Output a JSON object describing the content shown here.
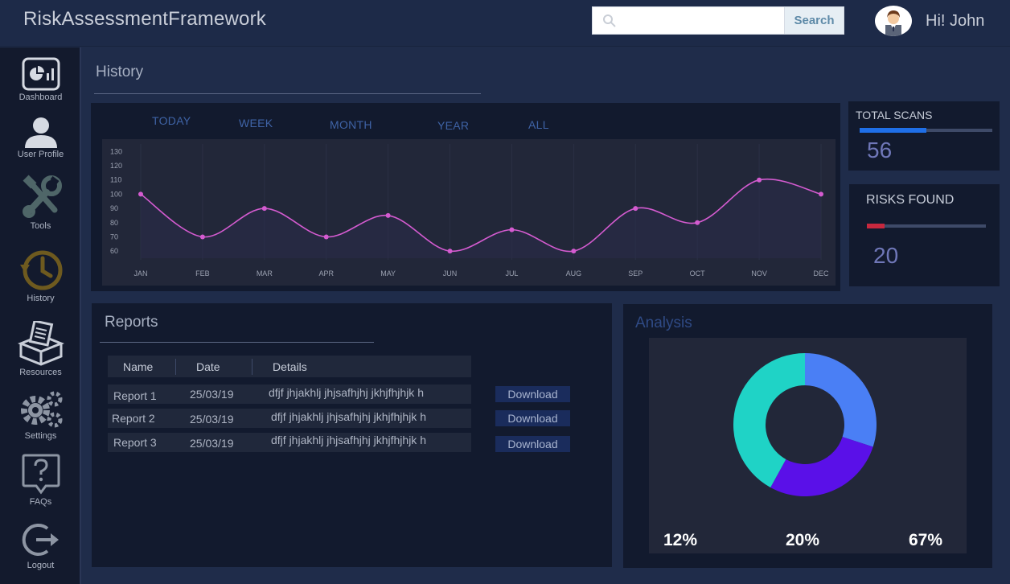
{
  "app": {
    "title": "RiskAssessmentFramework"
  },
  "header": {
    "search_placeholder": "",
    "search_button": "Search",
    "greeting": "Hi! John"
  },
  "sidebar": {
    "items": [
      {
        "label": "Dashboard",
        "icon": "dashboard-icon"
      },
      {
        "label": "User Profile",
        "icon": "user-icon"
      },
      {
        "label": "Tools",
        "icon": "tools-icon"
      },
      {
        "label": "History",
        "icon": "history-icon"
      },
      {
        "label": "Resources",
        "icon": "resources-box-icon"
      },
      {
        "label": "Settings",
        "icon": "settings-gears-icon"
      },
      {
        "label": "FAQs",
        "icon": "question-icon"
      },
      {
        "label": "Logout",
        "icon": "logout-icon"
      }
    ]
  },
  "history": {
    "title": "History",
    "tabs": [
      "TODAY",
      "WEEK",
      "MONTH",
      "YEAR",
      "ALL"
    ]
  },
  "stats": {
    "total_scans": {
      "label": "TOTAL SCANS",
      "value": "56",
      "fill": 0.5,
      "color": "#1f6fe8"
    },
    "risks_found": {
      "label": "RISKS FOUND",
      "value": "20",
      "fill": 0.15,
      "color": "#c8283e"
    }
  },
  "reports": {
    "title": "Reports",
    "columns": [
      "Name",
      "Date",
      "Details"
    ],
    "rows": [
      {
        "name": "Report 1",
        "date": "25/03/19",
        "details": "dfjf jhjakhlj jhjsafhjhj jkhjfhjhjk h",
        "action": "Download"
      },
      {
        "name": "Report 2",
        "date": "25/03/19",
        "details": "dfjf jhjakhlj jhjsafhjhj jkhjfhjhjk h",
        "action": "Download"
      },
      {
        "name": "Report 3",
        "date": "25/03/19",
        "details": "dfjf jhjakhlj jhjsafhjhj jkhjfhjhjk h",
        "action": "Download"
      }
    ]
  },
  "analysis": {
    "title": "Analysis",
    "labels": [
      "12%",
      "20%",
      "67%"
    ]
  },
  "chart_data": [
    {
      "type": "line",
      "title": "",
      "xlabel": "",
      "ylabel": "",
      "categories": [
        "JAN",
        "FEB",
        "MAR",
        "APR",
        "MAY",
        "JUN",
        "JUL",
        "AUG",
        "SEP",
        "OCT",
        "NOV",
        "DEC"
      ],
      "series": [
        {
          "values": [
            100,
            70,
            90,
            70,
            85,
            60,
            75,
            60,
            90,
            80,
            110,
            100
          ],
          "color": "#d45bd0"
        }
      ],
      "yticks": [
        60,
        70,
        80,
        90,
        100,
        110,
        120,
        130
      ],
      "ylim": [
        55,
        133
      ],
      "grid": true,
      "legend": "none"
    },
    {
      "type": "pie",
      "title": "",
      "slices": [
        {
          "value": 30,
          "color": "#4a7ff5"
        },
        {
          "value": 28,
          "color": "#5a10e8"
        },
        {
          "value": 42,
          "color": "#1fd3c6"
        }
      ],
      "legend": "none"
    }
  ]
}
